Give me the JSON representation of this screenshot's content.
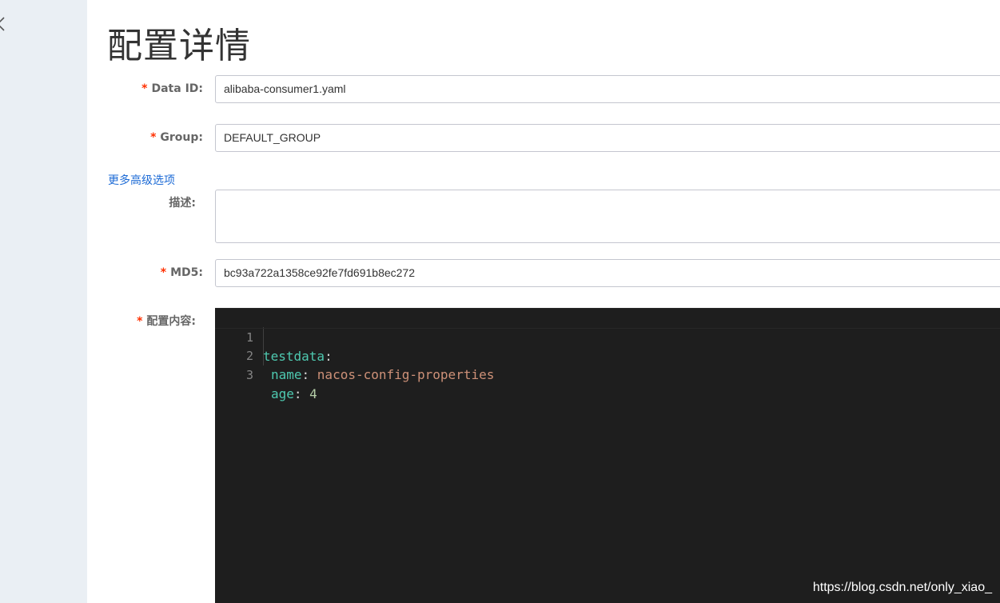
{
  "sidebar": {
    "collapse_icon": "chevron-left-icon"
  },
  "page": {
    "title": "配置详情"
  },
  "form": {
    "data_id": {
      "label": "Data ID:",
      "value": "alibaba-consumer1.yaml"
    },
    "group": {
      "label": "Group:",
      "value": "DEFAULT_GROUP"
    },
    "advanced_link": "更多高级选项",
    "description": {
      "label": "描述:",
      "value": ""
    },
    "md5": {
      "label": "MD5:",
      "value": "bc93a722a1358ce92fe7fd691b8ec272"
    },
    "content": {
      "label": "配置内容:",
      "lines": [
        {
          "num": "1",
          "key": "testdata",
          "sep": ":",
          "value": ""
        },
        {
          "num": "2",
          "key": "name",
          "sep": ": ",
          "value": "nacos-config-properties"
        },
        {
          "num": "3",
          "key": "age",
          "sep": ": ",
          "value": "4"
        }
      ]
    }
  },
  "required_mark": "*",
  "watermark": "https://blog.csdn.net/only_xiao_",
  "colors": {
    "sidebar_bg": "#eaeff4",
    "required": "#ff3000",
    "link": "#1d6bd6",
    "editor_bg": "#1e1e1e",
    "yaml_key": "#4ec9b0",
    "yaml_string": "#ce9178",
    "yaml_number": "#b5cea8"
  }
}
